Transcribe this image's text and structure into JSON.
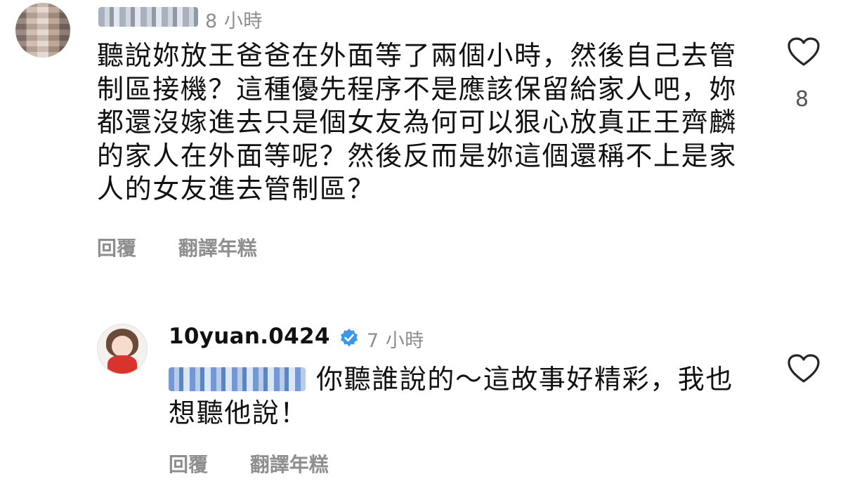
{
  "comments": [
    {
      "time": "8 小時",
      "text": "聽說妳放王爸爸在外面等了兩個小時，然後自己去管制區接機？這種優先程序不是應該保留給家人吧，妳都還沒嫁進去只是個女友為何可以狠心放真正王齊麟的家人在外面等呢？然後反而是妳這個還稱不上是家人的女友進去管制區？",
      "reply_label": "回覆",
      "translate_label": "翻譯年糕",
      "likes": "8"
    },
    {
      "username": "10yuan.0424",
      "time": "7 小時",
      "text": "你聽誰說的～這故事好精彩，我也想聽他說！",
      "reply_label": "回覆",
      "translate_label": "翻譯年糕"
    }
  ],
  "colors": {
    "verified": "#3897f0",
    "meta": "#8e8e8e",
    "text": "#111111"
  },
  "icons": {
    "like": "heart-icon",
    "verified": "verified-badge-icon"
  }
}
